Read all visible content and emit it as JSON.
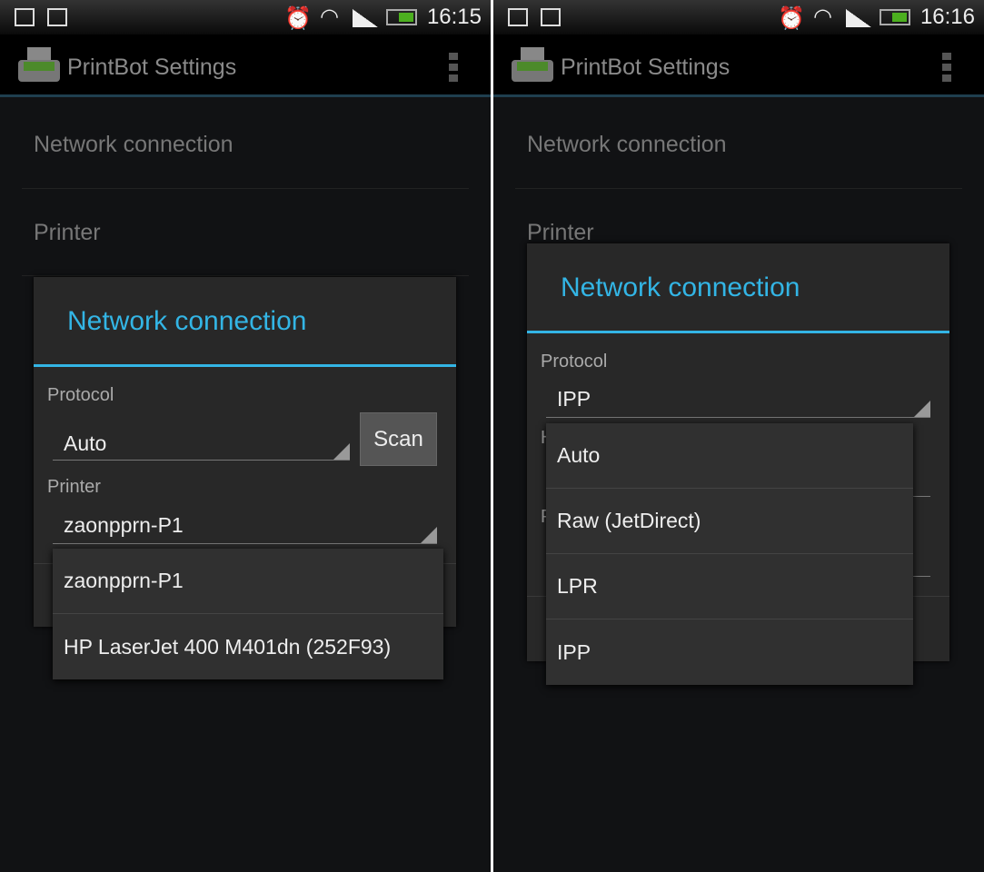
{
  "left": {
    "status": {
      "time": "16:15"
    },
    "app_title": "PrintBot Settings",
    "list": [
      "Network connection",
      "Printer"
    ],
    "dialog": {
      "title": "Network connection",
      "protocol_label": "Protocol",
      "protocol_value": "Auto",
      "scan_label": "Scan",
      "printer_label": "Printer",
      "printer_value": "zaonpprn-P1"
    },
    "dropdown": [
      "zaonpprn-P1",
      "HP LaserJet 400 M401dn (252F93)"
    ]
  },
  "right": {
    "status": {
      "time": "16:16"
    },
    "app_title": "PrintBot Settings",
    "list": [
      "Network connection",
      "Printer"
    ],
    "dialog": {
      "title": "Network connection",
      "protocol_label": "Protocol",
      "protocol_value": "IPP",
      "hidden_label_1": "H",
      "hidden_label_2": "P"
    },
    "dropdown": [
      "Auto",
      "Raw (JetDirect)",
      "LPR",
      "IPP"
    ]
  },
  "colors": {
    "accent": "#33b5e5",
    "battery": "#4caf1f"
  }
}
